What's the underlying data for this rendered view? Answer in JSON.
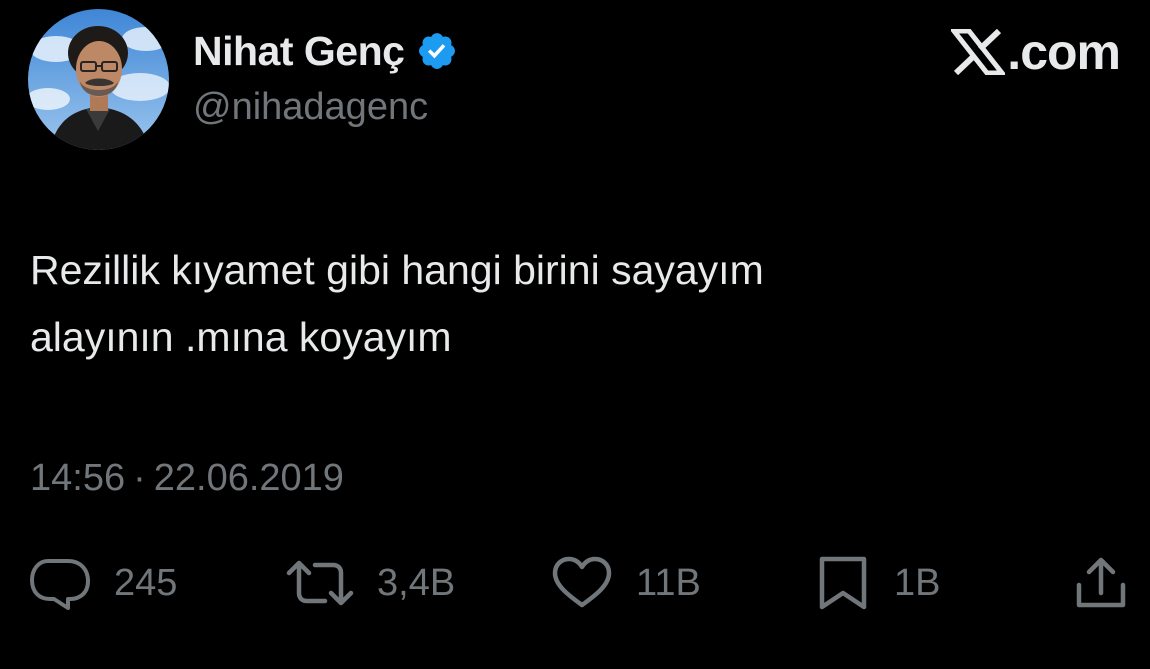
{
  "author": {
    "display_name": "Nihat Genç",
    "handle": "@nihadagenc",
    "verified_icon": "verified-badge-icon",
    "verified_color": "#1d9bf0"
  },
  "brand": {
    "icon": "x-logo-icon",
    "text": ".com"
  },
  "tweet": {
    "lines": [
      "Rezillik kıyamet gibi hangi birini sayayım",
      "alayının .mına koyayım"
    ]
  },
  "meta": {
    "time": "14:56",
    "separator": "·",
    "date": "22.06.2019"
  },
  "actions": {
    "reply": {
      "icon": "reply-icon",
      "count": "245"
    },
    "repost": {
      "icon": "repost-icon",
      "count": "3,4B"
    },
    "like": {
      "icon": "heart-icon",
      "count": "11B"
    },
    "bookmark": {
      "icon": "bookmark-icon",
      "count": "1B"
    },
    "share": {
      "icon": "share-icon"
    }
  },
  "colors": {
    "background": "#000000",
    "primary_text": "#e7e9ea",
    "secondary_text": "#71767b"
  }
}
